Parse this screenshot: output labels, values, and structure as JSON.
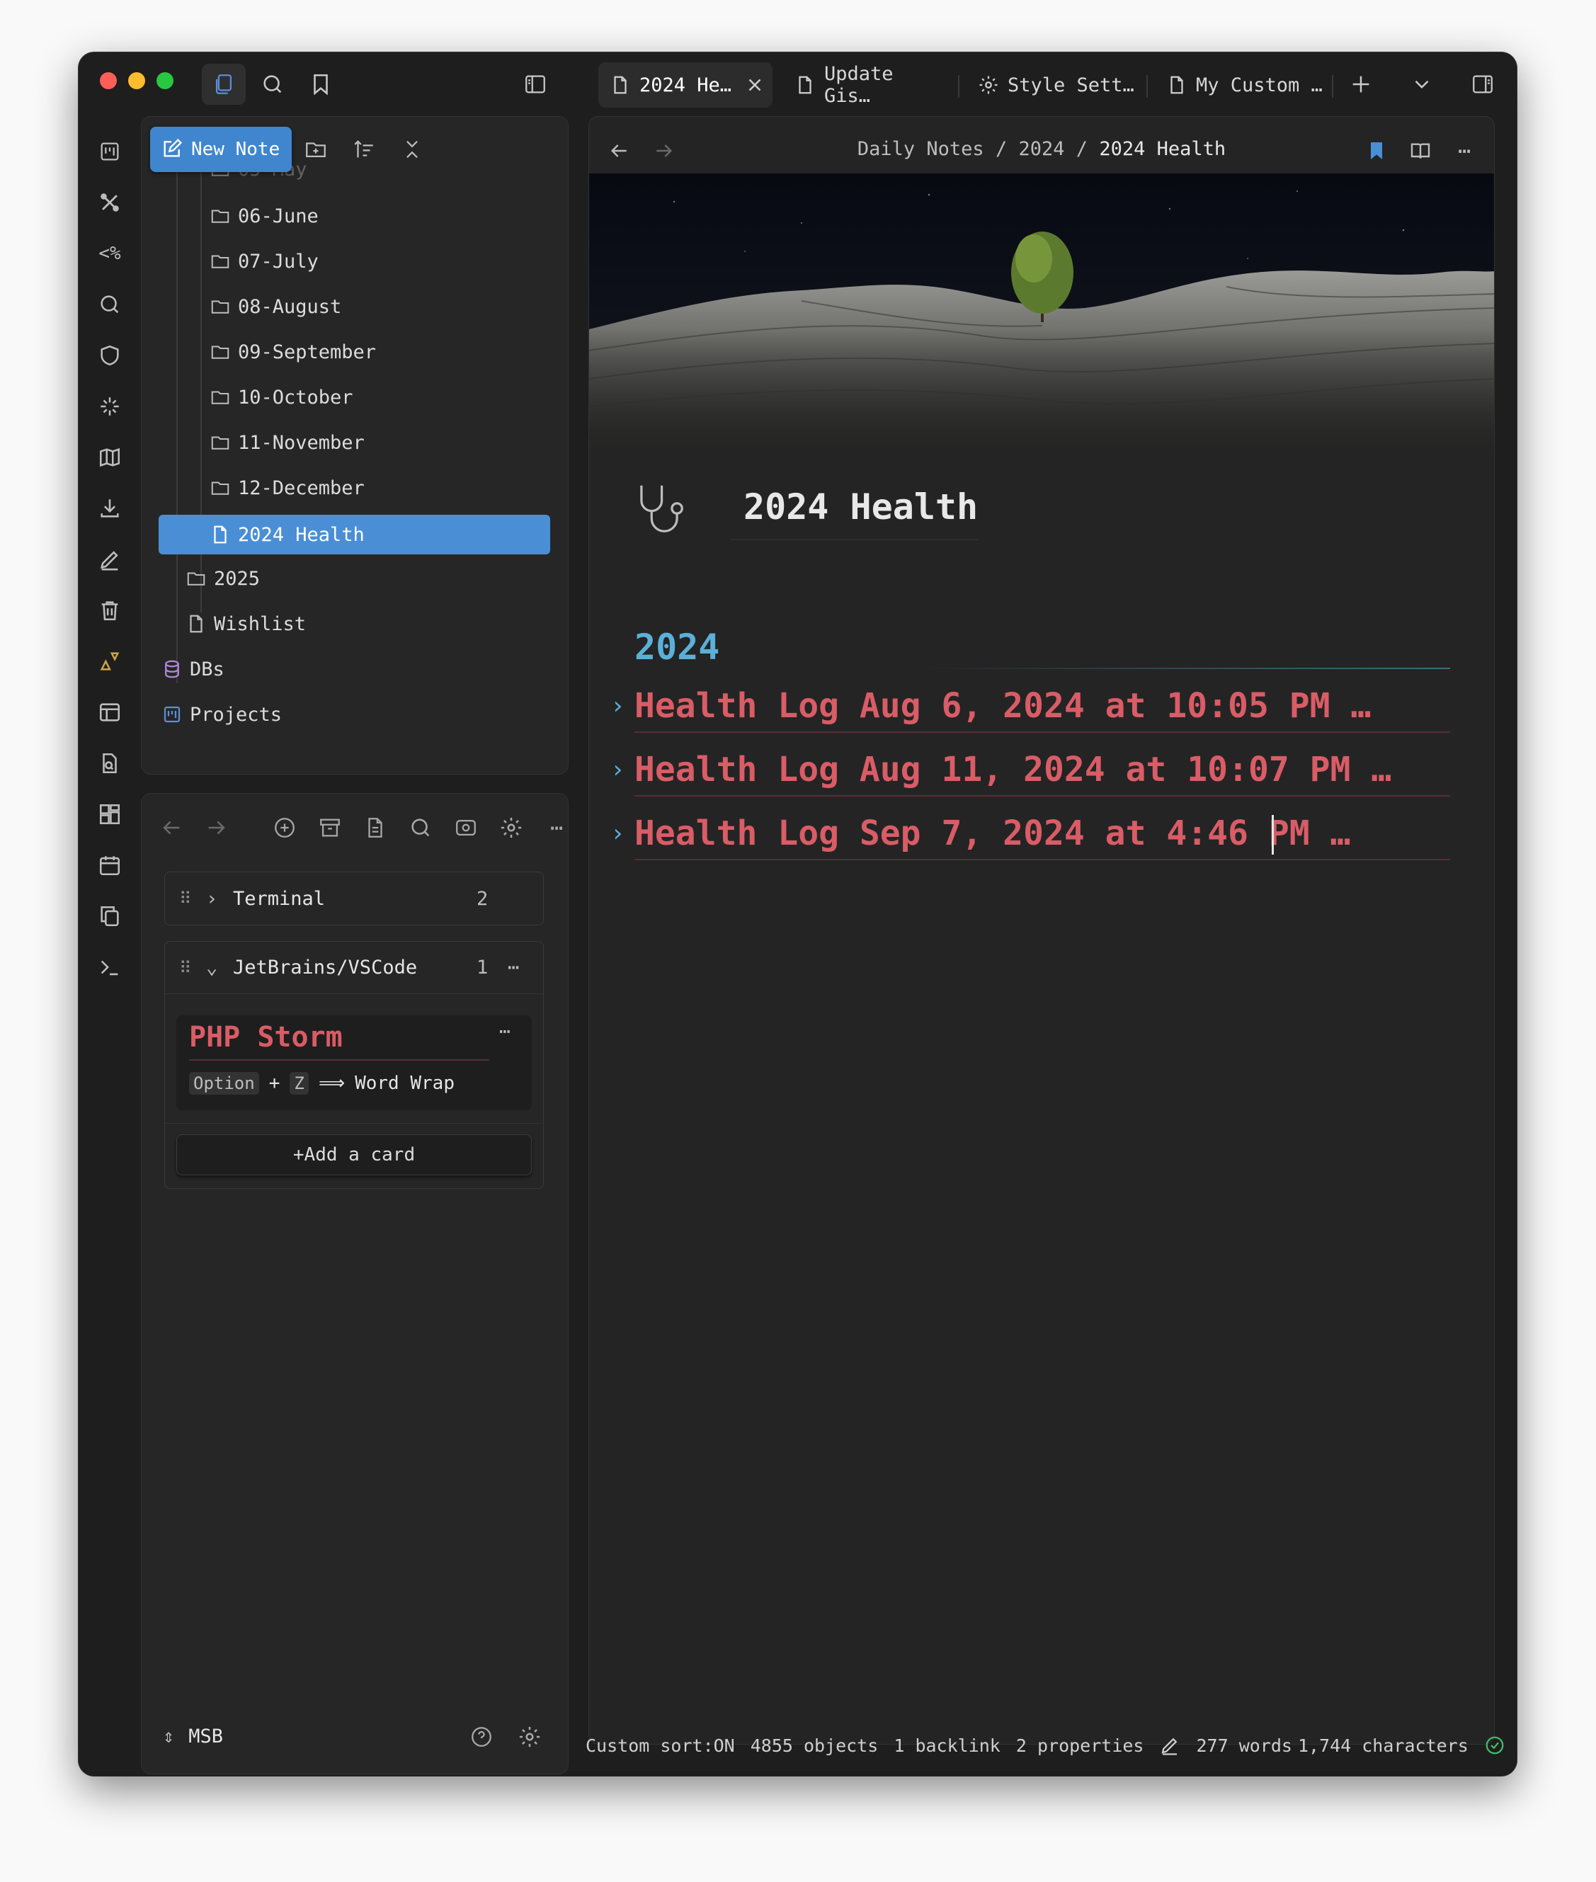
{
  "tabs": [
    {
      "label": "2024 He…",
      "icon": "file-icon",
      "active": true
    },
    {
      "label": "Update Gis…",
      "icon": "file-icon"
    },
    {
      "label": "Style Sett…",
      "icon": "gear-icon"
    },
    {
      "label": "My Custom …",
      "icon": "file-icon"
    }
  ],
  "file_explorer": {
    "new_note_label": "New Note",
    "partial_item": "05-May",
    "items": [
      {
        "label": "06-June",
        "type": "folder"
      },
      {
        "label": "07-July",
        "type": "folder"
      },
      {
        "label": "08-August",
        "type": "folder"
      },
      {
        "label": "09-September",
        "type": "folder"
      },
      {
        "label": "10-October",
        "type": "folder"
      },
      {
        "label": "11-November",
        "type": "folder"
      },
      {
        "label": "12-December",
        "type": "folder"
      },
      {
        "label": "2024 Health",
        "type": "file",
        "active": true
      },
      {
        "label": "2025",
        "type": "folder"
      },
      {
        "label": "Wishlist",
        "type": "file"
      },
      {
        "label": "DBs",
        "type": "database"
      },
      {
        "label": "Projects",
        "type": "kanban"
      }
    ]
  },
  "kanban": {
    "lanes": [
      {
        "title": "Terminal",
        "count": "2",
        "collapsed": true
      },
      {
        "title": "JetBrains/VSCode",
        "count": "1",
        "collapsed": false
      }
    ],
    "card": {
      "title": "PHP Storm",
      "key1": "Option",
      "plus": "+",
      "key2": "Z",
      "arrow": "⟹",
      "action": "Word Wrap"
    },
    "add_card": "+Add a card"
  },
  "vault": {
    "name": "MSB"
  },
  "breadcrumb": {
    "part1": "Daily Notes",
    "sep": "/",
    "part2": "2024",
    "current": "2024 Health"
  },
  "note": {
    "title": "2024 Health",
    "heading": "2024",
    "logs": [
      "Health Log Aug 6, 2024 at 10:05 PM …",
      "Health Log Aug 11, 2024 at 10:07 PM …",
      "Health Log Sep 7, 2024 at 4:46 PM …"
    ]
  },
  "status_bar": {
    "sort": "Custom sort:ON",
    "objects": "4855 objects",
    "backlinks": "1 backlink",
    "properties": "2 properties",
    "words": "277 words",
    "characters": "1,744 characters"
  },
  "colors": {
    "accent": "#4a8fd6",
    "heading": "#5ab0d8",
    "log": "#d95c66"
  }
}
